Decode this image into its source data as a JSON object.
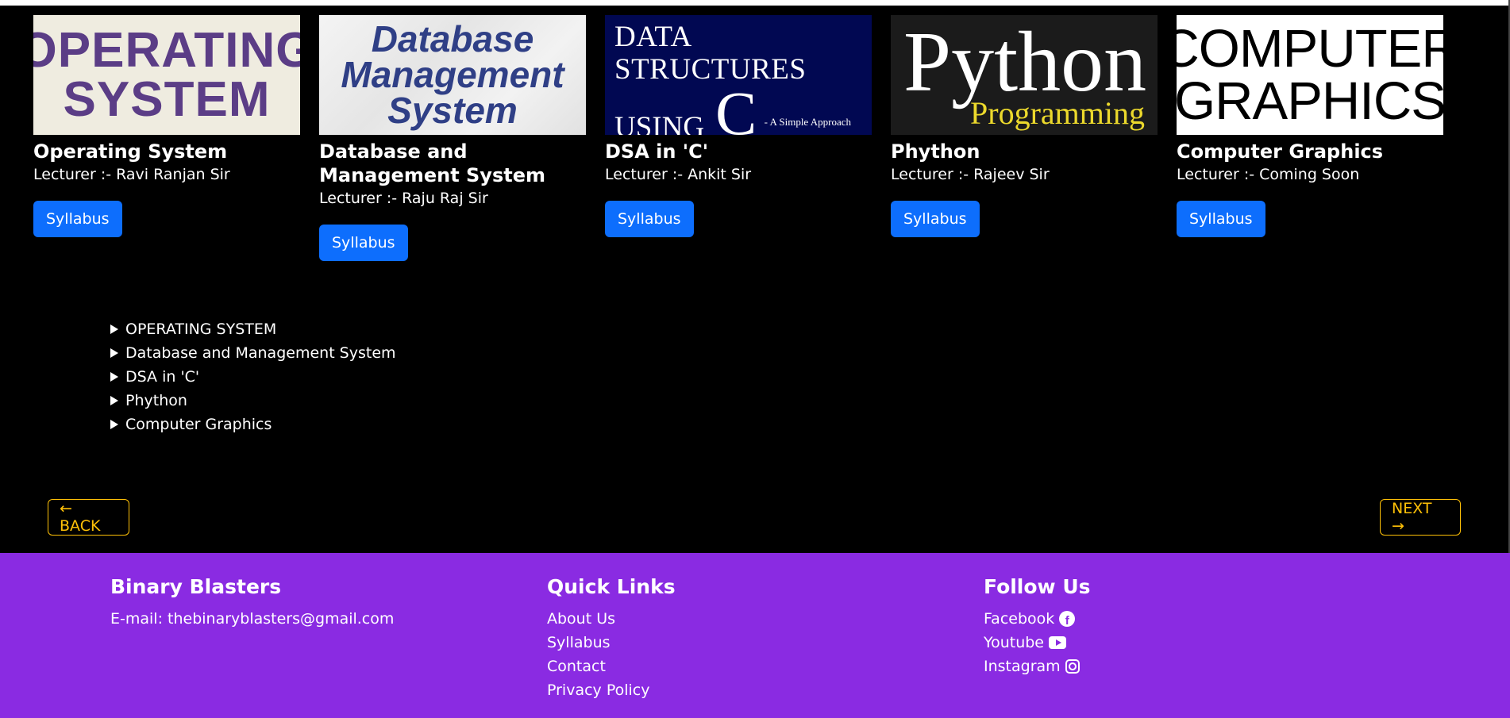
{
  "courses": [
    {
      "thumb_text": [
        "OPERATING",
        "SYSTEM"
      ],
      "title": "Operating System",
      "lecturer": "Lecturer :- Ravi Ranjan Sir",
      "button": "Syllabus"
    },
    {
      "thumb_text": [
        "Database",
        "Management",
        "System"
      ],
      "title": "Database and Management System",
      "lecturer": "Lecturer :- Raju Raj Sir",
      "button": "Syllabus"
    },
    {
      "thumb_text": [
        "DATA STRUCTURES",
        "USING",
        "C",
        "- A Simple Approach"
      ],
      "title": "DSA in 'C'",
      "lecturer": "Lecturer :- Ankit Sir",
      "button": "Syllabus"
    },
    {
      "thumb_text": [
        "Python",
        "Programming"
      ],
      "title": "Phython",
      "lecturer": "Lecturer :- Rajeev Sir",
      "button": "Syllabus"
    },
    {
      "thumb_text": [
        "COMPUTER",
        "GRAPHICS"
      ],
      "title": "Computer Graphics",
      "lecturer": "Lecturer :- Coming Soon",
      "button": "Syllabus"
    }
  ],
  "details": [
    "OPERATING SYSTEM",
    "Database and Management System",
    "DSA in 'C'",
    "Phython",
    "Computer Graphics"
  ],
  "nav": {
    "back": "← BACK",
    "next": "NEXT →"
  },
  "footer": {
    "brand": {
      "title": "Binary Blasters",
      "email": "E-mail: thebinaryblasters@gmail.com"
    },
    "quick_links": {
      "title": "Quick Links",
      "items": [
        "About Us",
        "Syllabus",
        "Contact",
        "Privacy Policy"
      ]
    },
    "follow": {
      "title": "Follow Us",
      "items": [
        {
          "label": "Facebook",
          "icon": "facebook-icon"
        },
        {
          "label": "Youtube",
          "icon": "youtube-icon"
        },
        {
          "label": "Instagram",
          "icon": "instagram-icon"
        }
      ]
    }
  },
  "colors": {
    "background": "#000000",
    "primary_button": "#0d6efd",
    "nav_outline": "#ffc107",
    "footer": "#8a2be2"
  }
}
